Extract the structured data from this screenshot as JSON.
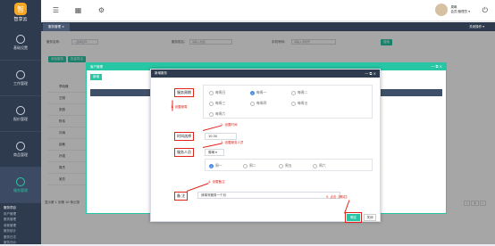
{
  "app": {
    "logo_text": "智享云",
    "logo_badge": "智"
  },
  "sidebar": {
    "items": [
      {
        "label": "基础设置"
      },
      {
        "label": "工作管理"
      },
      {
        "label": "报价管理"
      },
      {
        "label": "商品管理"
      },
      {
        "label": "服务管理"
      }
    ],
    "sub_items": [
      "服务项目",
      "用户管理",
      "服务管理",
      "收款管理",
      "服务统计",
      "服务日志",
      "服务评价"
    ]
  },
  "topbar": {
    "user_name": "周琳",
    "user_role": "会员/管理员 ▾"
  },
  "tabbar": {
    "tab_label": "服务管理 ×",
    "close_op": "关闭操作 ▾"
  },
  "content": {
    "filter_label1": "服务名称：",
    "filter_val1": "--选择名称--",
    "filter_label2": "服务姓名：",
    "filter_ph2": "请输入姓名",
    "filter_label3": "手机号码：",
    "filter_ph3": "请输入手机号",
    "search_btn": "搜索",
    "btn_add": "添加服务",
    "btn_batch": "批量导出",
    "row_labels": [
      "李晓峰",
      "王刚",
      "张丽",
      "陈伟",
      "刘涛",
      "赵敏",
      "孙强",
      "周杰",
      "吴芳"
    ],
    "footer": "显示第 1 到第 10 条记录"
  },
  "dialog_outer": {
    "title": "客户管理",
    "btn": "新增",
    "ctl": "— ⧉ ×"
  },
  "dialog_inner": {
    "title": "新增服务",
    "ctl": "— ⧉ ×",
    "period_label": "服务周期",
    "period_options": [
      "每周日",
      "每周一",
      "每周二",
      "每周三",
      "每周四",
      "每周五",
      "每周六"
    ],
    "period_selected": "每周一",
    "time_label": "时间选择",
    "time_value": "10:30",
    "staff_label": "服务人员",
    "staff_select": "周琳 ▾",
    "staff_options": [
      "周一",
      "周二",
      "周五",
      "周六"
    ],
    "remark_label": "备 注",
    "remark_value": "请填写服务一个月",
    "ok_btn": "确定",
    "cancel_btn": "关闭"
  },
  "annotations": {
    "a1": "1. 设置服周",
    "a2": "2. 设置时间",
    "a3": "3. 设置服务人员",
    "a4": "4. 设置备注",
    "a5": "5. 点击【确定】"
  },
  "pager": {
    "pages": [
      "‹",
      "1",
      "›"
    ]
  },
  "colors": {
    "accent": "#27c7a6",
    "sidebar": "#2e3a4d",
    "annotation": "#e0241b"
  }
}
